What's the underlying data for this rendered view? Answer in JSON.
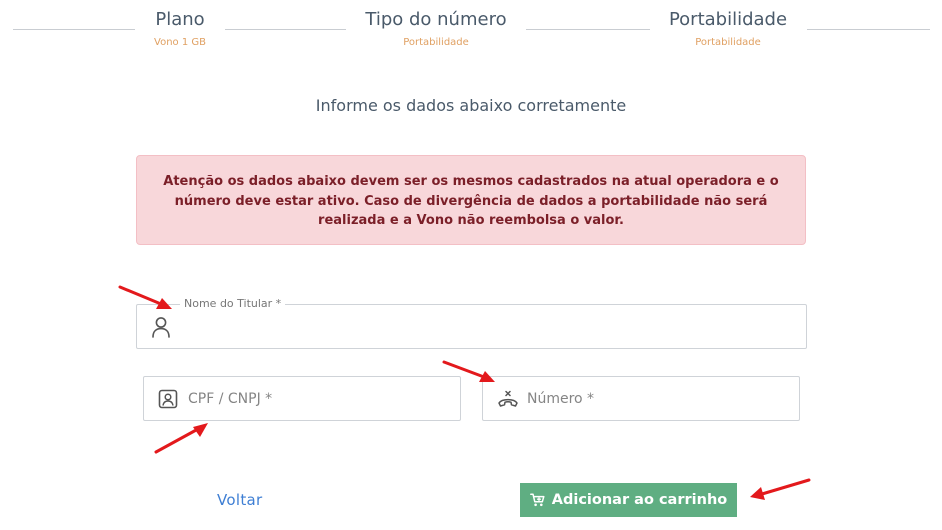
{
  "stepper": {
    "steps": [
      {
        "title": "Plano",
        "subtitle": "Vono 1 GB"
      },
      {
        "title": "Tipo do número",
        "subtitle": "Portabilidade"
      },
      {
        "title": "Portabilidade",
        "subtitle": "Portabilidade"
      }
    ]
  },
  "form": {
    "heading": "Informe os dados abaixo corretamente",
    "alert_text": "Atenção os dados abaixo devem ser os mesmos cadastrados na atual operadora e o número deve estar ativo. Caso de divergência de dados a portabilidade não será realizada e a Vono não reembolsa o valor.",
    "holder_name_label": "Nome do Titular *",
    "cpf_placeholder": "CPF / CNPJ *",
    "number_placeholder": "Número *"
  },
  "actions": {
    "back_label": "Voltar",
    "add_to_cart_label": "Adicionar ao carrinho"
  },
  "colors": {
    "accent_green": "#5fae82",
    "link_blue": "#3f7fd4",
    "step_subtitle": "#e0a062",
    "alert_bg": "#f8d7da",
    "alert_text": "#7b1f28",
    "annotation_arrow": "#e3191c"
  },
  "icons": {
    "holder_name": "user-icon",
    "cpf": "id-card-icon",
    "number": "phone-hangup-icon",
    "cart": "cart-icon"
  }
}
